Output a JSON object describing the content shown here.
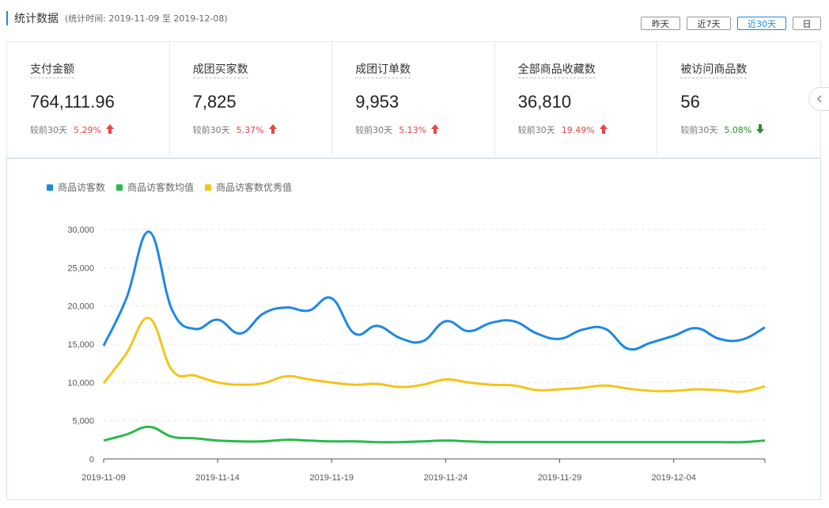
{
  "header": {
    "title": "统计数据",
    "range_text": "(统计时间: 2019-11-09 至 2019-12-08)"
  },
  "range_buttons": [
    {
      "label": "昨天",
      "active": false
    },
    {
      "label": "近7天",
      "active": false
    },
    {
      "label": "近30天",
      "active": true
    },
    {
      "label": "日",
      "active": false
    }
  ],
  "stats": [
    {
      "label": "支付金额",
      "value": "764,111.96",
      "compare_label": "较前30天",
      "change": "5.29%",
      "direction": "up"
    },
    {
      "label": "成团买家数",
      "value": "7,825",
      "compare_label": "较前30天",
      "change": "5.37%",
      "direction": "up"
    },
    {
      "label": "成团订单数",
      "value": "9,953",
      "compare_label": "较前30天",
      "change": "5.13%",
      "direction": "up"
    },
    {
      "label": "全部商品收藏数",
      "value": "36,810",
      "compare_label": "较前30天",
      "change": "19.49%",
      "direction": "up"
    },
    {
      "label": "被访问商品数",
      "value": "56",
      "compare_label": "较前30天",
      "change": "5.08%",
      "direction": "down"
    }
  ],
  "colors": {
    "accent": "#1e88e5",
    "up": "#e64545",
    "down": "#2e8b2e"
  },
  "icons": {
    "up_arrow": "arrow-up-icon",
    "down_arrow": "arrow-down-icon",
    "collapse": "chevron-left-icon"
  },
  "chart_data": {
    "type": "line",
    "x": [
      "2019-11-09",
      "2019-11-10",
      "2019-11-11",
      "2019-11-12",
      "2019-11-13",
      "2019-11-14",
      "2019-11-15",
      "2019-11-16",
      "2019-11-17",
      "2019-11-18",
      "2019-11-19",
      "2019-11-20",
      "2019-11-21",
      "2019-11-22",
      "2019-11-23",
      "2019-11-24",
      "2019-11-25",
      "2019-11-26",
      "2019-11-27",
      "2019-11-28",
      "2019-11-29",
      "2019-11-30",
      "2019-12-01",
      "2019-12-02",
      "2019-12-03",
      "2019-12-04",
      "2019-12-05",
      "2019-12-06",
      "2019-12-07",
      "2019-12-08"
    ],
    "x_tick_labels": [
      "2019-11-09",
      "2019-11-14",
      "2019-11-19",
      "2019-11-24",
      "2019-11-29",
      "2019-12-04"
    ],
    "y_ticks": [
      "0",
      "5,000",
      "10,000",
      "15,000",
      "20,000",
      "25,000",
      "30,000"
    ],
    "ylim": [
      0,
      30000
    ],
    "grid": true,
    "legend_position": "top-left",
    "series": [
      {
        "name": "商品访客数",
        "color": "#1e88e5",
        "values": [
          14800,
          21000,
          29700,
          19500,
          17000,
          18200,
          16400,
          19000,
          19800,
          19400,
          21000,
          16400,
          17400,
          15800,
          15400,
          18000,
          16700,
          17800,
          18000,
          16400,
          15700,
          16900,
          17000,
          14400,
          15200,
          16100,
          17100,
          15700,
          15600,
          17200
        ]
      },
      {
        "name": "商品访客数均值",
        "color": "#2db84d",
        "values": [
          2400,
          3200,
          4200,
          2900,
          2700,
          2400,
          2300,
          2300,
          2500,
          2400,
          2300,
          2300,
          2200,
          2200,
          2300,
          2400,
          2300,
          2200,
          2200,
          2200,
          2200,
          2200,
          2200,
          2200,
          2200,
          2200,
          2200,
          2200,
          2200,
          2400
        ]
      },
      {
        "name": "商品访客数优秀值",
        "color": "#f2c51b",
        "values": [
          9900,
          13800,
          18400,
          11600,
          10900,
          10000,
          9700,
          9900,
          10800,
          10400,
          10000,
          9700,
          9800,
          9400,
          9700,
          10400,
          10000,
          9700,
          9600,
          9000,
          9100,
          9300,
          9600,
          9200,
          8900,
          8900,
          9100,
          9000,
          8800,
          9500
        ]
      }
    ]
  }
}
